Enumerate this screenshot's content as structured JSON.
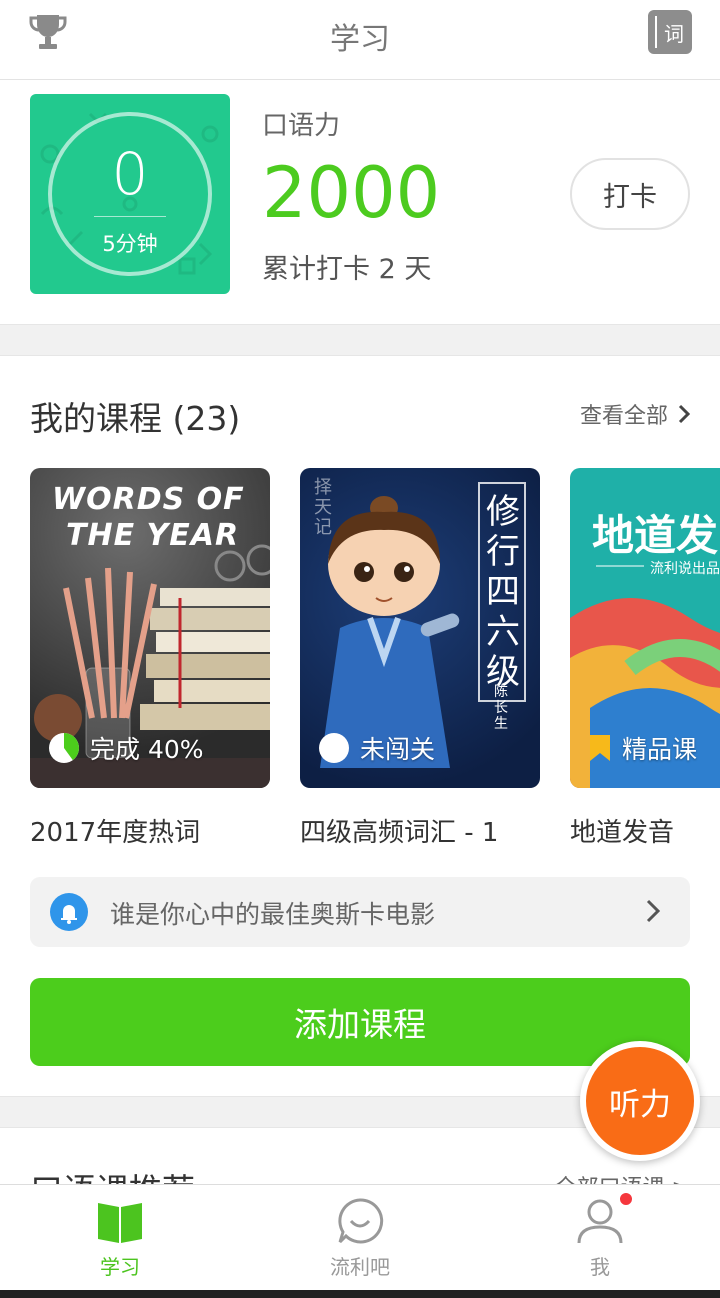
{
  "header": {
    "title": "学习",
    "dict_label": "词",
    "trophy_icon": "trophy-icon"
  },
  "stats": {
    "timer_value": "0",
    "timer_unit": "5分钟",
    "label": "口语力",
    "value": "2000",
    "checkin_days": "累计打卡 2 天",
    "checkin_button": "打卡"
  },
  "courses": {
    "title": "我的课程 (23)",
    "view_all": "查看全部",
    "items": [
      {
        "cover_title_line1": "WORDS OF",
        "cover_title_line2": "THE YEAR",
        "badge": "完成 40%",
        "progress": 0.4,
        "name": "2017年度热词"
      },
      {
        "cover_title": "修行四六级",
        "cover_author": "陈长生",
        "cover_tag": "择天记",
        "badge": "未闯关",
        "name": "四级高频词汇 - 1"
      },
      {
        "cover_title": "地道发",
        "cover_sub": "流利说出品",
        "badge": "精品课",
        "name": "地道发音"
      }
    ],
    "notice": "谁是你心中的最佳奥斯卡电影",
    "add_button": "添加课程"
  },
  "fab_label": "听力",
  "recommend": {
    "title": "口语课推荐",
    "more": "全部口语课 >"
  },
  "nav": {
    "items": [
      {
        "label": "学习",
        "active": true
      },
      {
        "label": "流利吧",
        "active": false
      },
      {
        "label": "我",
        "active": false
      }
    ]
  },
  "colors": {
    "accent_green": "#4ccd1c",
    "timer_green": "#22c98e",
    "fab_orange": "#f96c16",
    "bell_blue": "#2f95ea"
  }
}
